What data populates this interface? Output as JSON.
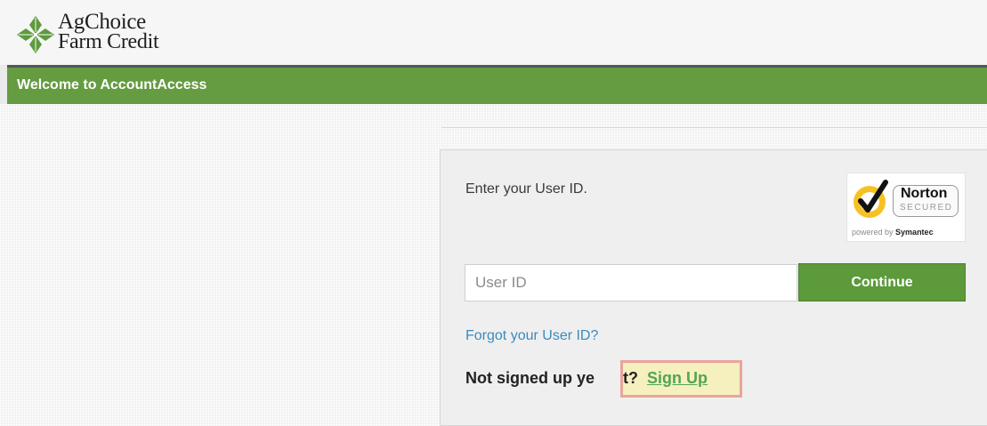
{
  "header": {
    "logo": {
      "line1": "AgChoice",
      "line2": "Farm Credit"
    }
  },
  "welcome_bar": {
    "title": "Welcome to AccountAccess"
  },
  "login": {
    "prompt": "Enter your User ID.",
    "userid_placeholder": "User ID",
    "userid_value": "",
    "continue_label": "Continue",
    "forgot_link": "Forgot your User ID?",
    "not_signed_up": "Not signed up ye",
    "not_signed_up_tail": "t?",
    "signup_link": "Sign Up"
  },
  "norton_badge": {
    "name": "Norton",
    "secured": "SECURED",
    "powered_prefix": "powered by",
    "powered_brand": "Symantec"
  },
  "colors": {
    "brand_green": "#659b41",
    "button_green": "#5c9a3c",
    "link_blue": "#3a8bbd",
    "signup_green": "#52a552"
  }
}
